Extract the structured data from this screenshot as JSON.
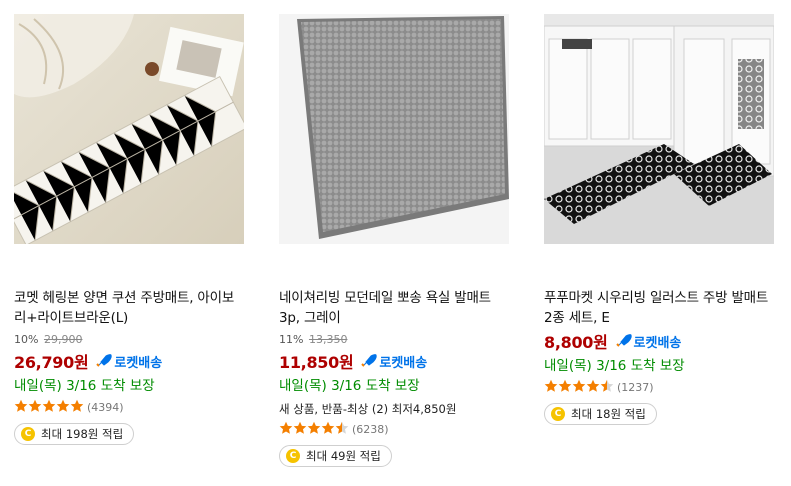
{
  "products": [
    {
      "title": "코멧 헤링본 양면 쿠션 주방매트, 아이보리+라이트브라운(L)",
      "discount": "10%",
      "original_price": "29,900",
      "price": "26,790원",
      "badge": "로켓배송",
      "delivery": "내일(목) 3/16 도착 보장",
      "extra": "",
      "rating": 5,
      "review_count": "(4394)",
      "reward": "최대 198원 적립"
    },
    {
      "title": "네이쳐리빙 모던데일 뽀송 욕실 발매트 3p, 그레이",
      "discount": "11%",
      "original_price": "13,350",
      "price": "11,850원",
      "badge": "로켓배송",
      "delivery": "내일(목) 3/16 도착 보장",
      "extra": "새 상품, 반품-최상 (2) 최저4,850원",
      "rating": 4.5,
      "review_count": "(6238)",
      "reward": "최대 49원 적립"
    },
    {
      "title": "푸푸마켓 시우리빙 일러스트 주방 발매트 2종 세트, E",
      "discount": "",
      "original_price": "",
      "price": "8,800원",
      "badge": "로켓배송",
      "delivery": "내일(목) 3/16 도착 보장",
      "extra": "",
      "rating": 4.5,
      "review_count": "(1237)",
      "reward": "최대 18원 적립"
    }
  ],
  "colors": {
    "price": "#ae0000",
    "rocket": "#0073e9",
    "delivery": "#008c00",
    "star": "#f47f00",
    "coin": "#f6c300"
  },
  "icons": [
    "rocket-icon",
    "star-icon",
    "coin-icon"
  ]
}
